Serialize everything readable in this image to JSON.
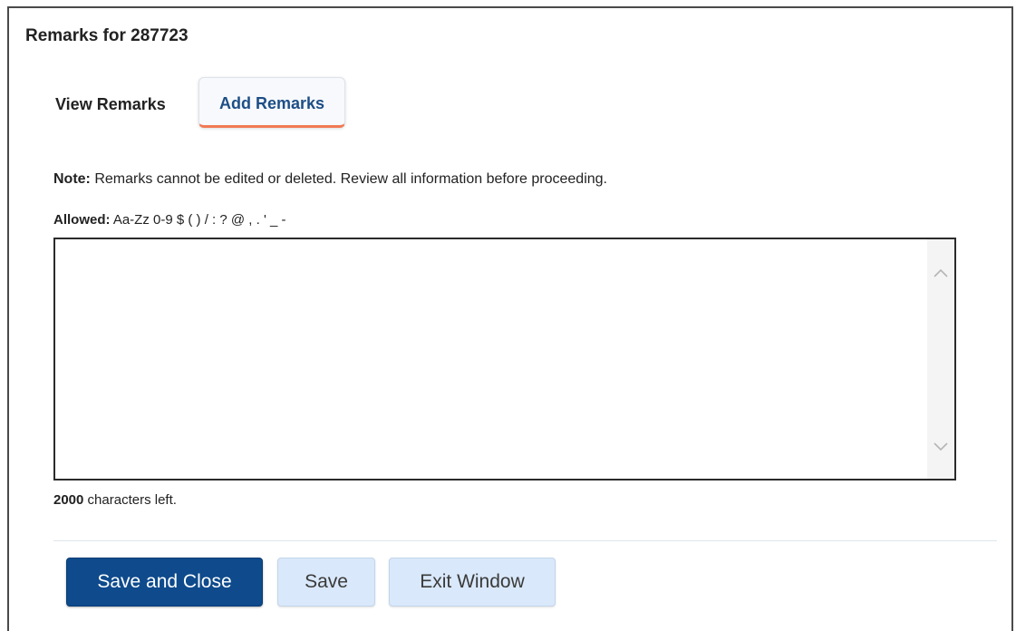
{
  "window": {
    "title": "Remarks for 287723"
  },
  "tabs": [
    {
      "label": "View Remarks",
      "active": false
    },
    {
      "label": "Add Remarks",
      "active": true
    }
  ],
  "note": {
    "label": "Note:",
    "text": " Remarks cannot be edited or deleted. Review all information before proceeding."
  },
  "allowed": {
    "label": "Allowed:",
    "text": " Aa-Zz 0-9 $ ( ) / : ? @ , . ' _ -"
  },
  "remarks_input": {
    "value": ""
  },
  "chars_left": {
    "count": "2000",
    "text": " characters left."
  },
  "buttons": {
    "save_and_close": "Save and Close",
    "save": "Save",
    "exit_window": "Exit Window"
  },
  "colors": {
    "primary_button": "#0e4a8c",
    "secondary_button": "#d9e8fa",
    "active_tab_underline": "#f07a55",
    "active_tab_text": "#1d4e86"
  },
  "icons": {
    "scroll_up": "chevron-up-icon",
    "scroll_down": "chevron-down-icon"
  }
}
